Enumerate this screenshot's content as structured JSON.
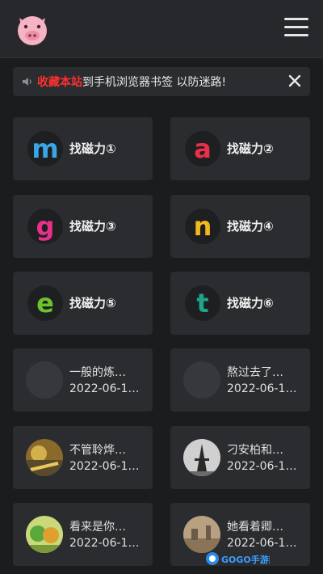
{
  "notice": {
    "highlight": "收藏本站",
    "text": "到手机浏览器书签 以防迷路!"
  },
  "links": [
    {
      "letter": "m",
      "label": "找磁力①",
      "color": "#3aa6e8"
    },
    {
      "letter": "a",
      "label": "找磁力②",
      "color": "#e8304a"
    },
    {
      "letter": "g",
      "label": "找磁力③",
      "color": "#e8308a"
    },
    {
      "letter": "n",
      "label": "找磁力④",
      "color": "#f2b81c"
    },
    {
      "letter": "e",
      "label": "找磁力⑤",
      "color": "#6cc32e"
    },
    {
      "letter": "t",
      "label": "找磁力⑥",
      "color": "#1fa58a"
    }
  ],
  "posts": [
    {
      "title": "一般的炼…",
      "date": "2022-06-1…"
    },
    {
      "title": "熬过去了…",
      "date": "2022-06-1…"
    },
    {
      "title": "不管聆烨…",
      "date": "2022-06-1…"
    },
    {
      "title": "刁安柏和…",
      "date": "2022-06-1…"
    },
    {
      "title": "看来是你…",
      "date": "2022-06-1…"
    },
    {
      "title": "她看着卿…",
      "date": "2022-06-1…"
    }
  ],
  "watermark": {
    "text": "GOGO手游网"
  }
}
